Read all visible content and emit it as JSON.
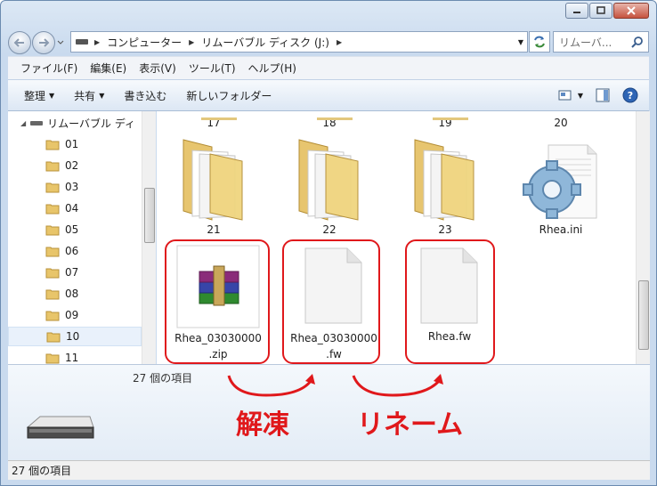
{
  "window": {
    "address_crumbs": [
      "コンピューター",
      "リムーバブル ディスク (J:)"
    ],
    "search_placeholder": "リムーバ...",
    "menu": [
      "ファイル(F)",
      "編集(E)",
      "表示(V)",
      "ツール(T)",
      "ヘルプ(H)"
    ],
    "commands": [
      "整理",
      "共有",
      "書き込む",
      "新しいフォルダー"
    ]
  },
  "nav": {
    "drive_label": "リムーバブル ディ",
    "folders": [
      "01",
      "02",
      "03",
      "04",
      "05",
      "06",
      "07",
      "08",
      "09",
      "10",
      "11"
    ],
    "selected": "10"
  },
  "content": {
    "top_row_labels": [
      "17",
      "18",
      "19",
      "20"
    ],
    "folders": [
      "21",
      "22",
      "23"
    ],
    "ini_file": "Rhea.ini",
    "files": [
      {
        "line1": "Rhea_03030000",
        "line2": ".zip",
        "type": "winrar"
      },
      {
        "line1": "Rhea_03030000",
        "line2": ".fw",
        "type": "blank"
      },
      {
        "line1": "Rhea.fw",
        "line2": "",
        "type": "blank"
      }
    ]
  },
  "details": {
    "item_count": "27 個の項目"
  },
  "status": {
    "text": "27 個の項目"
  },
  "annotations": {
    "left": "解凍",
    "right": "リネーム",
    "color": "#e0181b"
  }
}
